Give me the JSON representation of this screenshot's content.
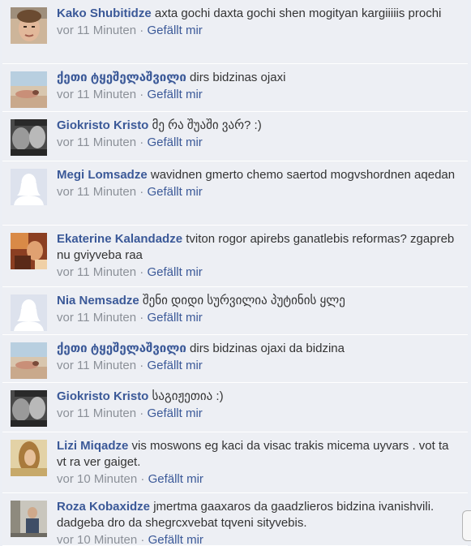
{
  "comments": [
    {
      "author": "Kako Shubitidze",
      "text": "axta gochi daxta gochi shen mogityan kargiiiiis prochi",
      "time": "vor 11 Minuten",
      "like": "Gefällt mir",
      "avatar": "avatar-photo-man-face"
    },
    {
      "author": "ქეთი ტყეშელაშვილი",
      "text": "dirs bidzinas ojaxi",
      "time": "vor 11 Minuten",
      "like": "Gefällt mir",
      "avatar": "avatar-photo-beach"
    },
    {
      "author": "Giokristo Kristo",
      "text": "მე რა შუაში ვარ? :)",
      "time": "vor 11 Minuten",
      "like": "Gefällt mir",
      "avatar": "avatar-photo-bw-faces"
    },
    {
      "author": "Megi Lomsadze",
      "text": "wavidnen gmerto chemo saertod mogvshordnen aqedan",
      "time": "vor 11 Minuten",
      "like": "Gefällt mir",
      "avatar": "avatar-default-female"
    },
    {
      "author": "Ekaterine Kalandadze",
      "text": "tviton rogor apirebs ganatlebis reformas? zgapreb nu gviyveba raa",
      "time": "vor 11 Minuten",
      "like": "Gefällt mir",
      "avatar": "avatar-photo-warm"
    },
    {
      "author": "Nia Nemsadze",
      "text": "შენი დიდი სურვილია პუტინის ყლე",
      "time": "vor 11 Minuten",
      "like": "Gefällt mir",
      "avatar": "avatar-default-female"
    },
    {
      "author": "ქეთი ტყეშელაშვილი",
      "text": "dirs bidzinas ojaxi da bidzina",
      "time": "vor 11 Minuten",
      "like": "Gefällt mir",
      "avatar": "avatar-photo-beach"
    },
    {
      "author": "Giokristo Kristo",
      "text": "საგიჟეთია :)",
      "time": "vor 11 Minuten",
      "like": "Gefällt mir",
      "avatar": "avatar-photo-bw-faces"
    },
    {
      "author": "Lizi Miqadze",
      "text": "vis moswons eg kaci da visac trakis micema uyvars . vot ta vt ra ver gaiget.",
      "time": "vor 10 Minuten",
      "like": "Gefällt mir",
      "avatar": "avatar-photo-woman"
    },
    {
      "author": "Roza Kobaxidze",
      "text": "jmertma gaaxaros da gaadzlieros bidzina ivanishvili. dadgeba dro da shegrcxvebat tqveni sityvebis.",
      "time": "vor 10 Minuten",
      "like": "Gefällt mir",
      "avatar": "avatar-photo-person-room"
    }
  ],
  "separator": "·",
  "colors": {
    "link": "#3b5998",
    "meta": "#8b9098",
    "row_bg": "#edeff4"
  }
}
